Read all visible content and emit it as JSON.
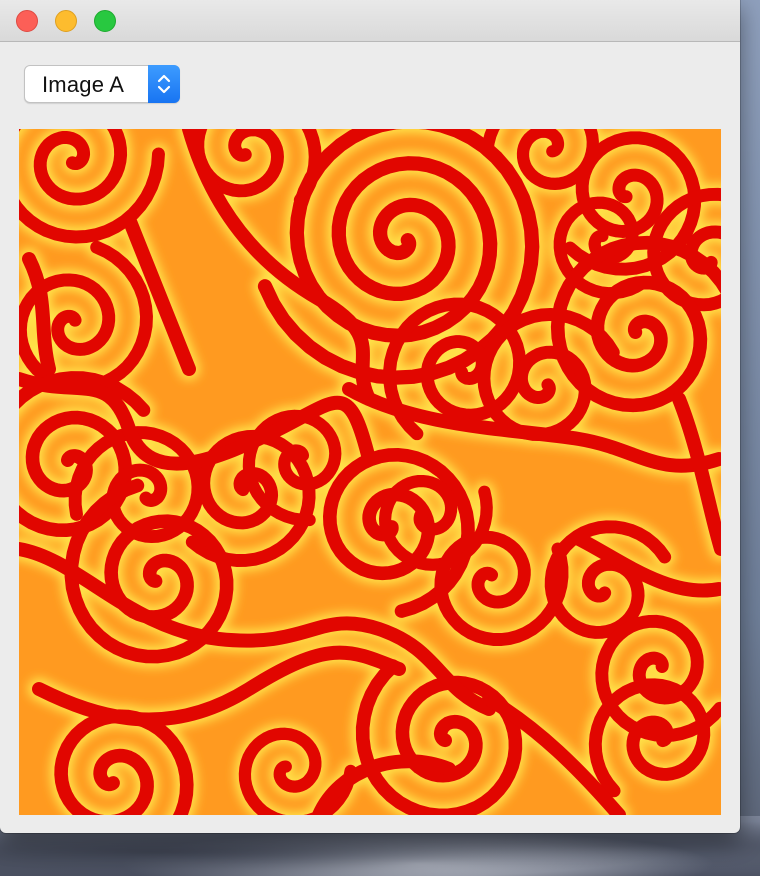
{
  "window": {
    "controls": [
      {
        "name": "close",
        "color": "#fc5f57"
      },
      {
        "name": "minimize",
        "color": "#fdbc2e"
      },
      {
        "name": "zoom",
        "color": "#28c840"
      }
    ]
  },
  "toolbar": {
    "image_select": {
      "selected": "Image A",
      "stepper_color": "#1874f2"
    }
  },
  "image": {
    "icon": "spiral-pattern-image",
    "colors": {
      "band_dark": "#e10600",
      "band_light": "#ffe24a",
      "band_mid": "#ff9a20"
    }
  }
}
